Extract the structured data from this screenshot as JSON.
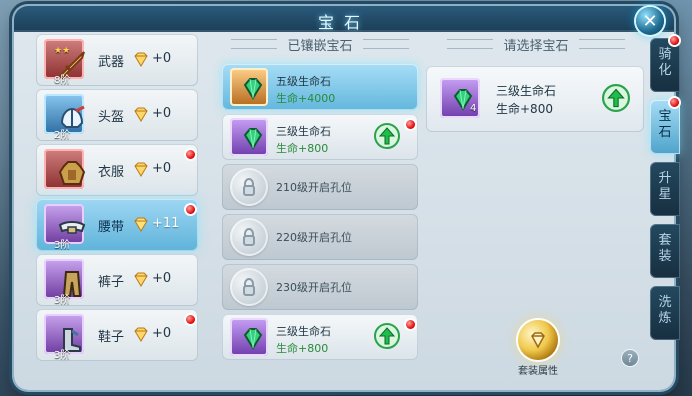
{
  "title": "宝石",
  "close_label": "✕",
  "equipment": [
    {
      "slot": "武器",
      "gems": "+0",
      "tier": "8阶",
      "stars": "★★",
      "selected": false,
      "alert": false,
      "thumb": "red"
    },
    {
      "slot": "头盔",
      "gems": "+0",
      "tier": "2阶",
      "stars": "",
      "selected": false,
      "alert": false,
      "thumb": "blue"
    },
    {
      "slot": "衣服",
      "gems": "+0",
      "tier": "",
      "stars": "",
      "selected": false,
      "alert": true,
      "thumb": "red"
    },
    {
      "slot": "腰带",
      "gems": "+11",
      "tier": "3阶",
      "stars": "",
      "selected": true,
      "alert": true,
      "thumb": "purple"
    },
    {
      "slot": "裤子",
      "gems": "+0",
      "tier": "3阶",
      "stars": "",
      "selected": false,
      "alert": false,
      "thumb": "purple"
    },
    {
      "slot": "鞋子",
      "gems": "+0",
      "tier": "3阶",
      "stars": "",
      "selected": false,
      "alert": true,
      "thumb": "purple"
    }
  ],
  "mid": {
    "header": "已镶嵌宝石",
    "sockets": [
      {
        "type": "gem",
        "name": "五级生命石",
        "effect": "生命+4000",
        "active": true,
        "upgrade": false,
        "alert": false,
        "thumb": "orange"
      },
      {
        "type": "gem",
        "name": "三级生命石",
        "effect": "生命+800",
        "active": false,
        "upgrade": true,
        "alert": true,
        "thumb": "purple"
      },
      {
        "type": "locked",
        "text": "210级开启孔位"
      },
      {
        "type": "locked",
        "text": "220级开启孔位"
      },
      {
        "type": "locked",
        "text": "230级开启孔位"
      },
      {
        "type": "gem",
        "name": "三级生命石",
        "effect": "生命+800",
        "active": false,
        "upgrade": true,
        "alert": true,
        "thumb": "purple"
      }
    ]
  },
  "right": {
    "header": "请选择宝石",
    "selected_gem": {
      "name": "三级生命石",
      "effect": "生命+800",
      "qty": "4"
    },
    "set_attr_label": "套装属性",
    "help_label": "?"
  },
  "tabs": [
    {
      "label": "骑\n化",
      "active": false,
      "alert": true
    },
    {
      "label": "宝\n石",
      "active": true,
      "alert": true
    },
    {
      "label": "升\n星",
      "active": false,
      "alert": false
    },
    {
      "label": "套\n装",
      "active": false,
      "alert": false
    },
    {
      "label": "洗\n炼",
      "active": false,
      "alert": false
    }
  ],
  "colors": {
    "accent": "#63b7dd",
    "alert": "#e00000",
    "effect_text": "#2a8a3b"
  }
}
